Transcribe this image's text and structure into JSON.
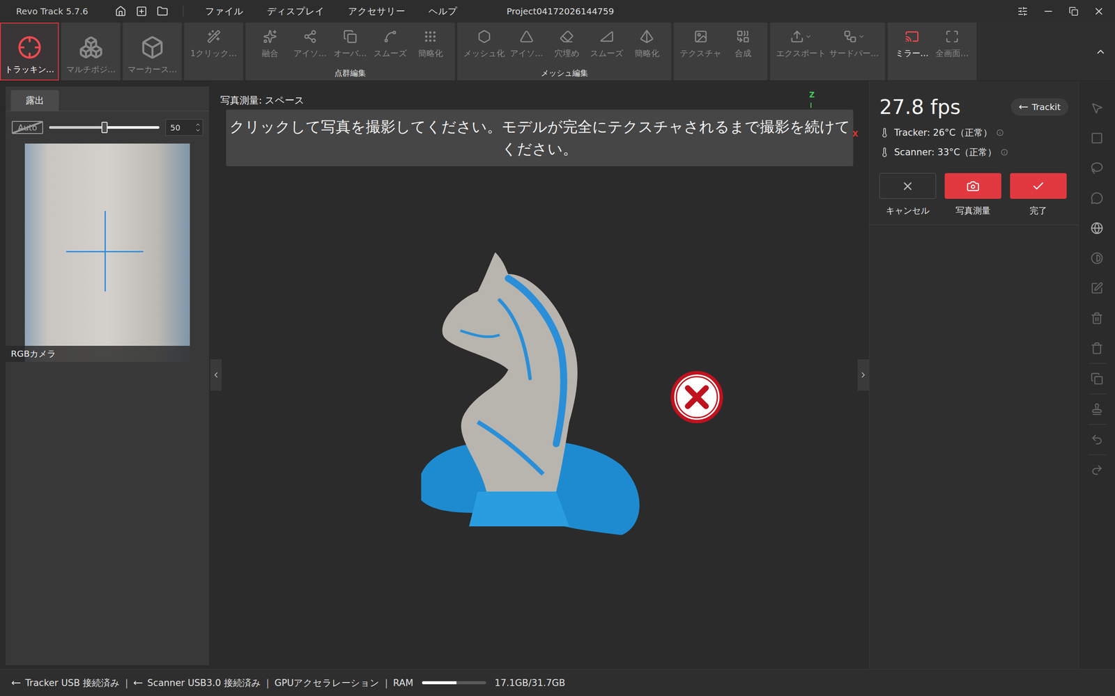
{
  "window": {
    "app": "Revo Track 5.7.6",
    "title": "Project04172026144759"
  },
  "menu": [
    {
      "label": "ファイル"
    },
    {
      "label": "ディスプレイ"
    },
    {
      "label": "アクセサリー"
    },
    {
      "label": "ヘルプ"
    }
  ],
  "toolbar": {
    "modes": [
      {
        "label": "トラッキン…",
        "selected": true,
        "disabled": false
      },
      {
        "label": "マルチポジ…",
        "selected": false,
        "disabled": true
      },
      {
        "label": "マーカース…",
        "selected": false,
        "disabled": true
      }
    ],
    "sections": [
      {
        "items": [
          {
            "label": "1クリック…",
            "disabled": true,
            "active": false,
            "dropdown": false
          }
        ]
      },
      {
        "caption": "点群編集",
        "items": [
          {
            "label": "融合",
            "disabled": true,
            "active": false,
            "dropdown": false
          },
          {
            "label": "アイソ…",
            "disabled": true,
            "active": false,
            "dropdown": false
          },
          {
            "label": "オーバ…",
            "disabled": true,
            "active": false,
            "dropdown": false
          },
          {
            "label": "スムーズ",
            "disabled": true,
            "active": false,
            "dropdown": false
          },
          {
            "label": "簡略化",
            "disabled": true,
            "active": false,
            "dropdown": false
          }
        ]
      },
      {
        "caption": "メッシュ編集",
        "items": [
          {
            "label": "メッシュ化",
            "disabled": true,
            "active": false,
            "dropdown": false
          },
          {
            "label": "アイソ…",
            "disabled": true,
            "active": false,
            "dropdown": false
          },
          {
            "label": "穴埋め",
            "disabled": true,
            "active": false,
            "dropdown": false
          },
          {
            "label": "スムーズ",
            "disabled": true,
            "active": false,
            "dropdown": false
          },
          {
            "label": "簡略化",
            "disabled": true,
            "active": false,
            "dropdown": false
          }
        ]
      },
      {
        "items": [
          {
            "label": "テクスチャ",
            "disabled": true,
            "active": false,
            "dropdown": false
          },
          {
            "label": "合成",
            "disabled": true,
            "active": false,
            "dropdown": false
          }
        ]
      },
      {
        "items": [
          {
            "label": "エクスポート",
            "disabled": true,
            "active": false,
            "dropdown": true
          },
          {
            "label": "サードパー…",
            "disabled": true,
            "active": false,
            "dropdown": true
          }
        ]
      },
      {
        "items": [
          {
            "label": "ミラー…",
            "disabled": false,
            "active": true,
            "dropdown": false
          },
          {
            "label": "全画面…",
            "disabled": true,
            "active": false,
            "dropdown": false
          }
        ]
      }
    ]
  },
  "left_panel": {
    "tabs": [
      {
        "label": "露出",
        "selected": true
      }
    ],
    "auto": {
      "label": "Auto",
      "checked": false
    },
    "exposure": {
      "level": 0.5,
      "value": "50"
    },
    "camera": {
      "label": "RGBカメラ"
    }
  },
  "viewport": {
    "mode_label": "写真測量: スペース",
    "banner": "クリックして写真を撮影してください。モデルが完全にテクスチャされるまで撮影を続けてください。",
    "axes": [
      {
        "label": "Z",
        "color": "#3ecf5a"
      },
      {
        "label": "X",
        "color": "#e0342f"
      }
    ]
  },
  "right_panel": {
    "fps": "27.8 fps",
    "trackit": "Trackit",
    "temperatures": [
      {
        "label": "Tracker: 26°C（正常）"
      },
      {
        "label": "Scanner: 33°C（正常）"
      }
    ],
    "actions": [
      {
        "label": "キャンセル",
        "kind": "cancel"
      },
      {
        "label": "写真測量",
        "kind": "photo"
      },
      {
        "label": "完了",
        "kind": "done"
      }
    ]
  },
  "side_rail": [
    {
      "disabled": true
    },
    {
      "disabled": true
    },
    {
      "disabled": true
    },
    {
      "disabled": true
    },
    {
      "disabled": false
    },
    {
      "disabled": true
    },
    {
      "disabled": true
    },
    {
      "disabled": true
    },
    {
      "disabled": true
    },
    {
      "disabled": true
    },
    {
      "disabled": true
    },
    {
      "disabled": true
    },
    {
      "disabled": true
    }
  ],
  "status_bar": {
    "separator": "|",
    "connections": [
      {
        "label": "Tracker USB 接続済み"
      },
      {
        "label": "Scanner USB3.0 接続済み"
      }
    ],
    "gpu": "GPUアクセラレーション",
    "ram": {
      "label": "RAM",
      "level": 0.54,
      "reading": "17.1GB/31.7GB"
    }
  }
}
